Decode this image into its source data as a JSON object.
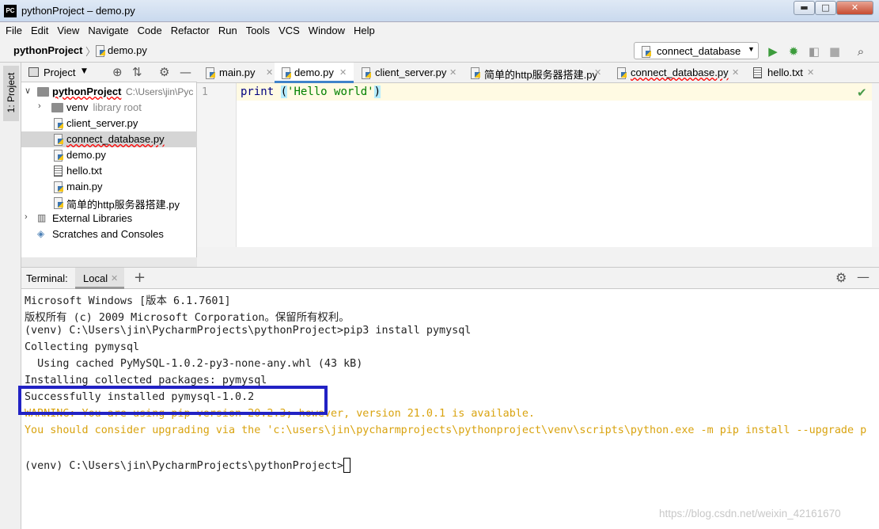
{
  "window": {
    "app_icon": "PC",
    "title": "pythonProject – demo.py",
    "minimize_label": "▬",
    "maximize_label": "□",
    "close_label": "✕"
  },
  "menu": [
    "File",
    "Edit",
    "View",
    "Navigate",
    "Code",
    "Refactor",
    "Run",
    "Tools",
    "VCS",
    "Window",
    "Help"
  ],
  "breadcrumb": {
    "project": "pythonProject",
    "file": "demo.py"
  },
  "run_config": {
    "selected": "connect_database"
  },
  "toolbar_icons": [
    "run-icon",
    "debug-icon",
    "coverage-icon",
    "stop-icon",
    "search-icon"
  ],
  "side_strip": {
    "project_label": "1: Project"
  },
  "project_panel": {
    "title": "Project",
    "root": {
      "name": "pythonProject",
      "path": "C:\\Users\\jin\\Pyc"
    },
    "items": [
      {
        "name": "venv",
        "hint": "library root",
        "type": "folder"
      },
      {
        "name": "client_server.py",
        "type": "py"
      },
      {
        "name": "connect_database.py",
        "type": "py",
        "selected": true
      },
      {
        "name": "demo.py",
        "type": "py"
      },
      {
        "name": "hello.txt",
        "type": "txt"
      },
      {
        "name": "main.py",
        "type": "py"
      },
      {
        "name": "简单的http服务器搭建.py",
        "type": "py"
      }
    ],
    "external_libraries": "External Libraries",
    "scratches": "Scratches and Consoles"
  },
  "editor_tabs": [
    {
      "label": "main.py",
      "type": "py"
    },
    {
      "label": "demo.py",
      "type": "py",
      "active": true
    },
    {
      "label": "client_server.py",
      "type": "py"
    },
    {
      "label": "简单的http服务器搭建.py",
      "type": "py"
    },
    {
      "label": "connect_database.py",
      "type": "py"
    },
    {
      "label": "hello.txt",
      "type": "txt"
    }
  ],
  "editor": {
    "line_number": "1",
    "code_keyword": "print",
    "code_open": "(",
    "code_string": "'Hello world'",
    "code_close": ")"
  },
  "terminal": {
    "title": "Terminal:",
    "tab": "Local",
    "lines": [
      "Microsoft Windows [版本 6.1.7601]",
      "版权所有 (c) 2009 Microsoft Corporation。保留所有权利。",
      "(venv) C:\\Users\\jin\\PycharmProjects\\pythonProject>pip3 install pymysql",
      "Collecting pymysql",
      "  Using cached PyMySQL-1.0.2-py3-none-any.whl (43 kB)",
      "Installing collected packages: pymysql",
      "Successfully installed pymysql-1.0.2",
      "WARNING: You are using pip version 20.2.3; however, version 21.0.1 is available.",
      "You should consider upgrading via the 'c:\\users\\jin\\pycharmprojects\\pythonproject\\venv\\scripts\\python.exe -m pip install --upgrade p",
      "",
      "(venv) C:\\Users\\jin\\PycharmProjects\\pythonProject>"
    ]
  },
  "watermark": "https://blog.csdn.net/weixin_42161670"
}
